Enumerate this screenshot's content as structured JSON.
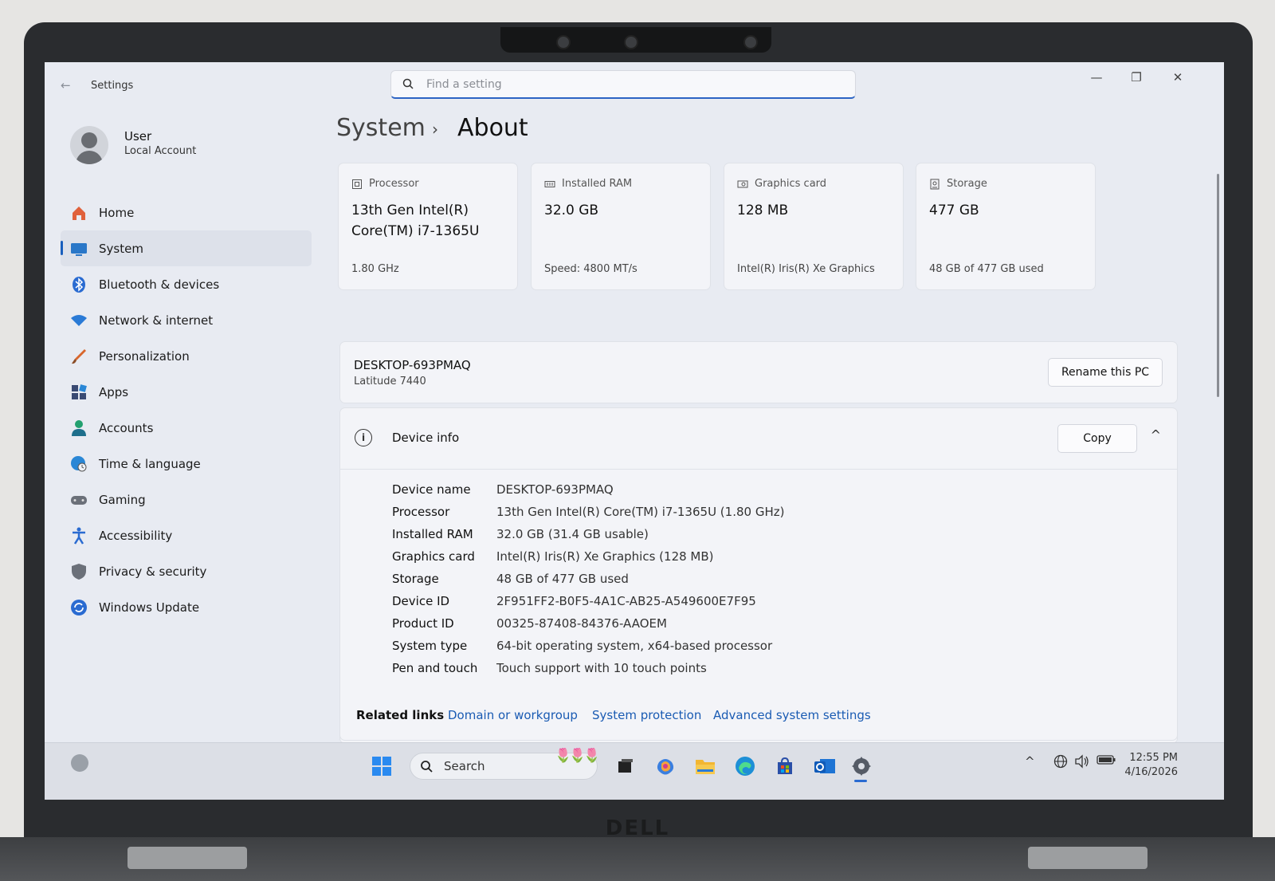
{
  "window": {
    "title": "Settings",
    "minimize_symbol": "—",
    "maximize_symbol": "❐",
    "close_symbol": "✕"
  },
  "search": {
    "placeholder": "Find a setting"
  },
  "profile": {
    "name": "User",
    "account_type": "Local Account"
  },
  "sidebar": {
    "items": [
      {
        "label": "Home",
        "icon": "home-icon",
        "color": "#e0613b"
      },
      {
        "label": "System",
        "icon": "monitor-icon",
        "color": "#2a77c8"
      },
      {
        "label": "Bluetooth & devices",
        "icon": "bluetooth-icon",
        "color": "#2a6bd1"
      },
      {
        "label": "Network & internet",
        "icon": "wifi-icon",
        "color": "#2a7ad6"
      },
      {
        "label": "Personalization",
        "icon": "brush-icon",
        "color": "#d8662c"
      },
      {
        "label": "Apps",
        "icon": "apps-icon",
        "color": "#3a4a73"
      },
      {
        "label": "Accounts",
        "icon": "person-icon",
        "color": "#23a06f"
      },
      {
        "label": "Time & language",
        "icon": "globe-clock-icon",
        "color": "#2a87d6"
      },
      {
        "label": "Gaming",
        "icon": "gamepad-icon",
        "color": "#6b7079"
      },
      {
        "label": "Accessibility",
        "icon": "accessibility-icon",
        "color": "#2a6bd1"
      },
      {
        "label": "Privacy & security",
        "icon": "shield-icon",
        "color": "#6b7079"
      },
      {
        "label": "Windows Update",
        "icon": "update-icon",
        "color": "#2a6bd1"
      }
    ],
    "active_index": 1
  },
  "breadcrumb": {
    "parent": "System",
    "separator": "›",
    "current": "About"
  },
  "cards": [
    {
      "title": "Processor",
      "value": "13th Gen Intel(R) Core(TM) i7-1365U",
      "sub": "1.80 GHz"
    },
    {
      "title": "Installed RAM",
      "value": "32.0 GB",
      "sub": "Speed: 4800 MT/s"
    },
    {
      "title": "Graphics card",
      "value": "128 MB",
      "sub": "Intel(R) Iris(R) Xe Graphics"
    },
    {
      "title": "Storage",
      "value": "477 GB",
      "sub": "48 GB of 477 GB used"
    }
  ],
  "pc": {
    "name": "DESKTOP-693PMAQ",
    "model": "Latitude 7440",
    "rename_label": "Rename this PC"
  },
  "device_info": {
    "title": "Device info",
    "copy_label": "Copy",
    "info_glyph": "i",
    "collapse_glyph": "^",
    "rows": [
      {
        "key": "Device name",
        "value": "DESKTOP-693PMAQ"
      },
      {
        "key": "Processor",
        "value": "13th Gen Intel(R) Core(TM) i7-1365U (1.80 GHz)"
      },
      {
        "key": "Installed RAM",
        "value": "32.0 GB (31.4 GB usable)"
      },
      {
        "key": "Graphics card",
        "value": "Intel(R) Iris(R) Xe Graphics (128 MB)"
      },
      {
        "key": "Storage",
        "value": "48 GB of 477 GB used"
      },
      {
        "key": "Device ID",
        "value": "2F951FF2-B0F5-4A1C-AB25-A549600E7F95"
      },
      {
        "key": "Product ID",
        "value": "00325-87408-84376-AAOEM"
      },
      {
        "key": "System type",
        "value": "64-bit operating system, x64-based processor"
      },
      {
        "key": "Pen and touch",
        "value": "Touch support with 10 touch points"
      }
    ]
  },
  "related_links": {
    "label": "Related links",
    "links": [
      "Domain or workgroup",
      "System protection",
      "Advanced system settings"
    ]
  },
  "taskbar": {
    "search_label": "Search",
    "tulips": "🌷🌷🌷",
    "tray_chevron": "^",
    "time": "12:55 PM",
    "date": "4/16/2026"
  },
  "hardware": {
    "brand": "DELL"
  },
  "colors": {
    "accent": "#2c64c4",
    "link": "#1a5bb3"
  }
}
